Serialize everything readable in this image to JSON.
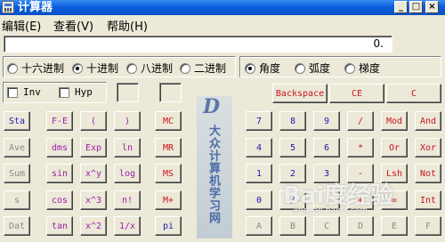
{
  "window": {
    "title": "计算器"
  },
  "menu": [
    {
      "label": "编辑",
      "accel": "(E)"
    },
    {
      "label": "查看",
      "accel": "(V)"
    },
    {
      "label": "帮助",
      "accel": "(H)"
    }
  ],
  "display": {
    "value": "0."
  },
  "number_base": [
    {
      "label": "十六进制",
      "selected": false
    },
    {
      "label": "十进制",
      "selected": true
    },
    {
      "label": "八进制",
      "selected": false
    },
    {
      "label": "二进制",
      "selected": false
    }
  ],
  "angle_mode": [
    {
      "label": "角度",
      "selected": true
    },
    {
      "label": "弧度",
      "selected": false
    },
    {
      "label": "梯度",
      "selected": false
    }
  ],
  "checkboxes": {
    "inv": "Inv",
    "hyp": "Hyp"
  },
  "buttons": {
    "backspace": "Backspace",
    "ce": "CE",
    "c": "C",
    "sta": "Sta",
    "fe": "F-E",
    "lparen": "(",
    "rparen": ")",
    "mc": "MC",
    "ave": "Ave",
    "dms": "dms",
    "exp": "Exp",
    "ln": "ln",
    "mr": "MR",
    "sum": "Sum",
    "sin": "sin",
    "xy": "x^y",
    "log": "log",
    "ms": "MS",
    "s": "s",
    "cos": "cos",
    "x3": "x^3",
    "nfact": "n!",
    "mplus": "M+",
    "dat": "Dat",
    "tan": "tan",
    "x2": "x^2",
    "recip": "1/x",
    "pi": "pi",
    "d7": "7",
    "d8": "8",
    "d9": "9",
    "div": "/",
    "mod": "Mod",
    "and": "And",
    "d4": "4",
    "d5": "5",
    "d6": "6",
    "mul": "*",
    "or": "Or",
    "xor": "Xor",
    "d1": "1",
    "d2": "2",
    "d3": "3",
    "sub": "-",
    "lsh": "Lsh",
    "not": "Not",
    "d0": "0",
    "sign": "+/-",
    "dot": ".",
    "add": "+",
    "eq": "=",
    "int": "Int",
    "a": "A",
    "b": "B",
    "cc": "C",
    "d": "D",
    "e": "E",
    "f": "F"
  },
  "colors": {
    "blue": "#1a1ab4",
    "red": "#c8141e",
    "purple": "#9b1ea6",
    "title": "#0A5EDA"
  }
}
